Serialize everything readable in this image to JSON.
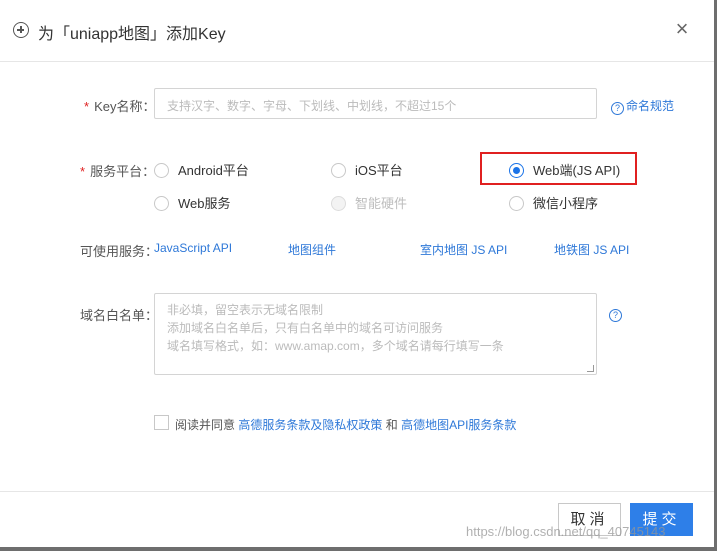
{
  "dialog": {
    "title": "为「uniapp地图」添加Key",
    "close_label": "×"
  },
  "key_name": {
    "required_mark": "*",
    "label": "Key名称：",
    "placeholder": "支持汉字、数字、字母、下划线、中划线，不超过15个",
    "naming_rule_link": "命名规范"
  },
  "platform": {
    "required_mark": "*",
    "label": "服务平台：",
    "selected": "Web端(JS API)",
    "options": [
      {
        "label": "Android平台",
        "checked": false,
        "disabled": false
      },
      {
        "label": "iOS平台",
        "checked": false,
        "disabled": false
      },
      {
        "label": "Web端(JS API)",
        "checked": true,
        "disabled": false
      },
      {
        "label": "Web服务",
        "checked": false,
        "disabled": false
      },
      {
        "label": "智能硬件",
        "checked": false,
        "disabled": true
      },
      {
        "label": "微信小程序",
        "checked": false,
        "disabled": false
      }
    ],
    "highlight_color": "#e02020"
  },
  "services": {
    "label": "可使用服务：",
    "items": [
      "JavaScript API",
      "地图组件",
      "室内地图 JS API",
      "地铁图 JS API"
    ]
  },
  "domain_whitelist": {
    "label": "域名白名单：",
    "placeholder_lines": [
      "非必填，留空表示无域名限制",
      "添加域名白名单后，只有白名单中的域名可访问服务",
      "域名填写格式，如：www.amap.com，多个域名请每行填写一条"
    ],
    "help_icon": "question-circle-icon"
  },
  "agreement": {
    "prefix": "阅读并同意",
    "link1": "高德服务条款及隐私权政策",
    "and": "和",
    "link2": "高德地图API服务条款"
  },
  "footer": {
    "cancel_label": "取消",
    "submit_label": "提交"
  },
  "watermark": "https://blog.csdn.net/qq_40745143",
  "colors": {
    "link": "#2e78d8",
    "primary": "#2e7fe8",
    "required": "#e02020"
  }
}
